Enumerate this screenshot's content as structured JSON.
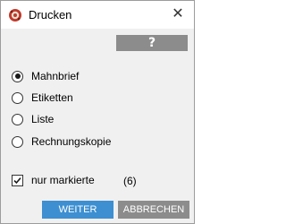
{
  "window": {
    "title": "Drucken",
    "app_icon": "printer-app-icon",
    "close_glyph": "✕"
  },
  "help_button": {
    "label": "?"
  },
  "options": [
    {
      "label": "Mahnbrief",
      "selected": true
    },
    {
      "label": "Etiketten",
      "selected": false
    },
    {
      "label": "Liste",
      "selected": false
    },
    {
      "label": "Rechnungskopie",
      "selected": false
    }
  ],
  "marked_only": {
    "label": "nur markierte",
    "checked": true,
    "count": "(6)"
  },
  "buttons": {
    "ok": "WEITER",
    "cancel": "ABBRECHEN"
  },
  "colors": {
    "primary_button": "#3d8fd1",
    "secondary_button": "#8c8c8c",
    "dialog_background": "#f0f0f0",
    "icon_red": "#c0392b"
  }
}
